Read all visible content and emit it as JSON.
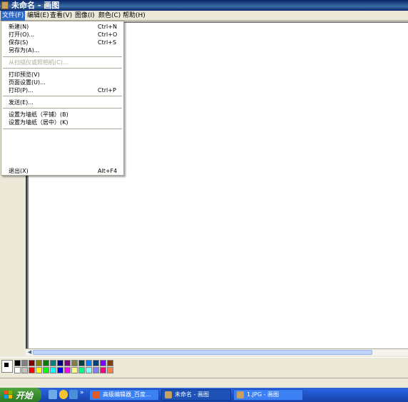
{
  "window": {
    "title": "未命名 - 画图"
  },
  "menubar": {
    "items": [
      {
        "label": "文件(F)"
      },
      {
        "label": "编辑(E)"
      },
      {
        "label": "查看(V)"
      },
      {
        "label": "图像(I)"
      },
      {
        "label": "颜色(C)"
      },
      {
        "label": "帮助(H)"
      }
    ]
  },
  "file_menu": {
    "new": {
      "label": "新建(N)",
      "shortcut": "Ctrl+N"
    },
    "open": {
      "label": "打开(O)...",
      "shortcut": "Ctrl+O"
    },
    "save": {
      "label": "保存(S)",
      "shortcut": "Ctrl+S"
    },
    "save_as": {
      "label": "另存为(A)..."
    },
    "from_scanner": {
      "label": "从扫描仪或照相机(C)..."
    },
    "print_preview": {
      "label": "打印预览(V)"
    },
    "page_setup": {
      "label": "页面设置(U)..."
    },
    "print": {
      "label": "打印(P)...",
      "shortcut": "Ctrl+P"
    },
    "send": {
      "label": "发送(E)..."
    },
    "wallpaper_tile": {
      "label": "设置为墙纸（平铺）(B)"
    },
    "wallpaper_center": {
      "label": "设置为墙纸（居中）(K)"
    },
    "exit": {
      "label": "退出(X)",
      "shortcut": "Alt+F4"
    }
  },
  "palette": {
    "colors": [
      "#000000",
      "#808080",
      "#800000",
      "#808000",
      "#008000",
      "#008080",
      "#000080",
      "#800080",
      "#808040",
      "#004040",
      "#0080FF",
      "#004080",
      "#8000FF",
      "#804000",
      "#FFFFFF",
      "#C0C0C0",
      "#FF0000",
      "#FFFF00",
      "#00FF00",
      "#00FFFF",
      "#0000FF",
      "#FF00FF",
      "#FFFF80",
      "#00FF80",
      "#80FFFF",
      "#8080FF",
      "#FF0080",
      "#FF8040"
    ]
  },
  "taskbar": {
    "start_label": "开始",
    "tasks": [
      {
        "label": "高级编辑器_百度..."
      },
      {
        "label": "未命名 - 画图"
      },
      {
        "label": "1.JPG - 画图"
      }
    ],
    "overflow": "»"
  }
}
